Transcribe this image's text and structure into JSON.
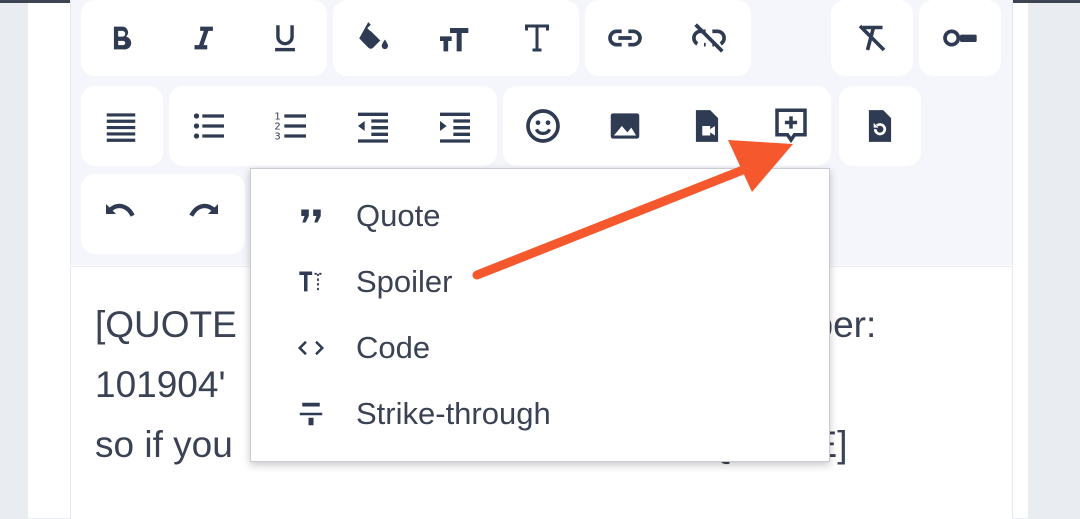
{
  "toolbar": {
    "row1": [
      {
        "name": "bold-button",
        "icon": "bold-icon"
      },
      {
        "name": "italic-button",
        "icon": "italic-icon"
      },
      {
        "name": "underline-button",
        "icon": "underline-icon"
      },
      {
        "name": "text-color-button",
        "icon": "paint-bucket-icon"
      },
      {
        "name": "font-size-button",
        "icon": "font-size-icon"
      },
      {
        "name": "font-family-button",
        "icon": "font-family-icon"
      },
      {
        "name": "insert-link-button",
        "icon": "link-icon"
      },
      {
        "name": "remove-link-button",
        "icon": "unlink-icon"
      },
      {
        "name": "clear-formatting-button",
        "icon": "clear-formatting-icon"
      },
      {
        "name": "toggle-button",
        "icon": "toggle-icon"
      }
    ],
    "row2": [
      {
        "name": "align-button",
        "icon": "align-justify-icon"
      },
      {
        "name": "bullet-list-button",
        "icon": "bullet-list-icon"
      },
      {
        "name": "numbered-list-button",
        "icon": "numbered-list-icon"
      },
      {
        "name": "outdent-button",
        "icon": "outdent-icon"
      },
      {
        "name": "indent-button",
        "icon": "indent-icon"
      },
      {
        "name": "emoji-button",
        "icon": "smiley-icon"
      },
      {
        "name": "insert-image-button",
        "icon": "image-icon"
      },
      {
        "name": "insert-media-button",
        "icon": "video-file-icon"
      },
      {
        "name": "insert-menu-button",
        "icon": "comment-plus-icon"
      },
      {
        "name": "drafts-button",
        "icon": "file-restore-icon"
      }
    ],
    "row3": [
      {
        "name": "undo-button",
        "icon": "undo-icon"
      },
      {
        "name": "redo-button",
        "icon": "redo-icon"
      }
    ]
  },
  "editor": {
    "text": "[QUOTE                                                member:\n101904'                                                  r text\nso if you                                              QUOTE]"
  },
  "insert_menu": {
    "items": [
      {
        "label": "Quote",
        "icon": "quote-icon"
      },
      {
        "label": "Spoiler",
        "icon": "spoiler-icon"
      },
      {
        "label": "Code",
        "icon": "code-icon"
      },
      {
        "label": "Strike-through",
        "icon": "strikethrough-icon"
      }
    ]
  },
  "annotation": {
    "color": "#f5582d"
  },
  "colors": {
    "icon": "#2f3b52",
    "toolbar_bg": "#f4f6fb",
    "button_bg": "#ffffff"
  }
}
